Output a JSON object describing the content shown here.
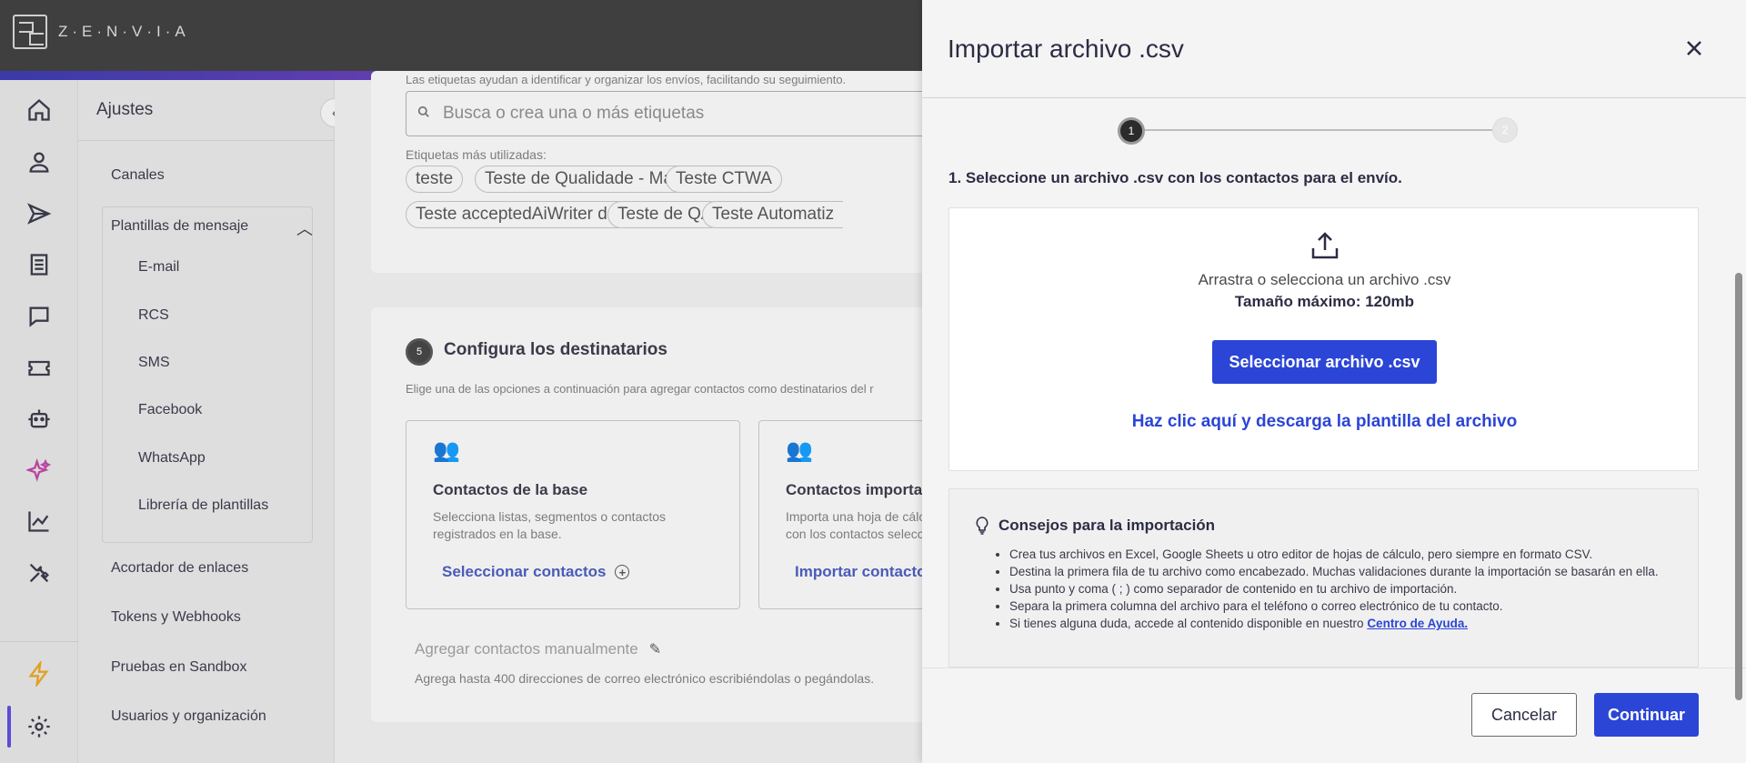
{
  "app": {
    "logo_text": "Z·E·N·V·I·A"
  },
  "rail": {
    "icons": [
      "home-icon",
      "user-icon",
      "send-icon",
      "document-icon",
      "chat-icon",
      "ticket-icon",
      "robot-icon",
      "sparkle-icon",
      "chart-icon",
      "tools-icon",
      "bolt-icon",
      "gear-icon"
    ],
    "colors": {
      "sparkle": "#b8479e",
      "bolt": "#e0a020",
      "active": "#5b4bd6"
    }
  },
  "sidebar": {
    "title": "Ajustes",
    "items": [
      {
        "label": "Canales"
      },
      {
        "label": "Plantillas de mensaje"
      },
      {
        "label": "Acortador de enlaces"
      },
      {
        "label": "Tokens y Webhooks"
      },
      {
        "label": "Pruebas en Sandbox"
      },
      {
        "label": "Usuarios y organización"
      }
    ],
    "subitems": [
      {
        "label": "E-mail"
      },
      {
        "label": "RCS"
      },
      {
        "label": "SMS"
      },
      {
        "label": "Facebook"
      },
      {
        "label": "WhatsApp"
      },
      {
        "label": "Librería de plantillas"
      }
    ]
  },
  "main": {
    "tags_help": "Las etiquetas ayudan a identificar y organizar los envíos, facilitando su seguimiento.",
    "tags_placeholder": "Busca o crea una o más etiquetas",
    "most_used_label": "Etiquetas más utilizadas:",
    "chips": [
      "teste",
      "Teste de Qualidade - Manual",
      "Teste CTWA",
      "Teste acceptedAiWriter dois",
      "Teste de QA",
      "Teste Automatiz"
    ],
    "step5": {
      "number": "5",
      "title": "Configura los destinatarios",
      "description": "Elige una de las opciones a continuación para agregar contactos como destinatarios del r"
    },
    "card_base": {
      "title": "Contactos de la base",
      "description": "Selecciona listas, segmentos o contactos registrados en la base.",
      "action": "Seleccionar contactos"
    },
    "card_import": {
      "title": "Contactos importa",
      "description": "Importa una hoja de cálc con los contactos selecc",
      "action": "Importar contacto"
    },
    "manual_title": "Agregar contactos manualmente",
    "manual_desc": "Agrega hasta 400 direcciones de correo electrónico escribiéndolas o pegándolas."
  },
  "drawer": {
    "title": "Importar archivo .csv",
    "steps": [
      "1",
      "2"
    ],
    "instruction": "1. Seleccione un archivo .csv con los contactos para el envío.",
    "drag_text": "Arrastra o selecciona un archivo .csv",
    "max_size": "Tamaño máximo: 120mb",
    "select_button": "Seleccionar archivo .csv",
    "template_link": "Haz clic aquí y descarga la plantilla del archivo",
    "tips_title": "Consejos para la importación",
    "tips": [
      "Crea tus archivos en Excel, Google Sheets u otro editor de hojas de cálculo, pero siempre en formato CSV.",
      "Destina la primera fila de tu archivo como encabezado. Muchas validaciones durante la importación se basarán en ella.",
      "Usa punto y coma ( ; ) como separador de contenido en tu archivo de importación.",
      "Separa la primera columna del archivo para el teléfono o correo electrónico de tu contacto.",
      "Si tienes alguna duda, accede al contenido disponible en nuestro"
    ],
    "help_link": "Centro de Ayuda.",
    "cancel": "Cancelar",
    "continue": "Continuar",
    "accent": "#2b45d6"
  }
}
